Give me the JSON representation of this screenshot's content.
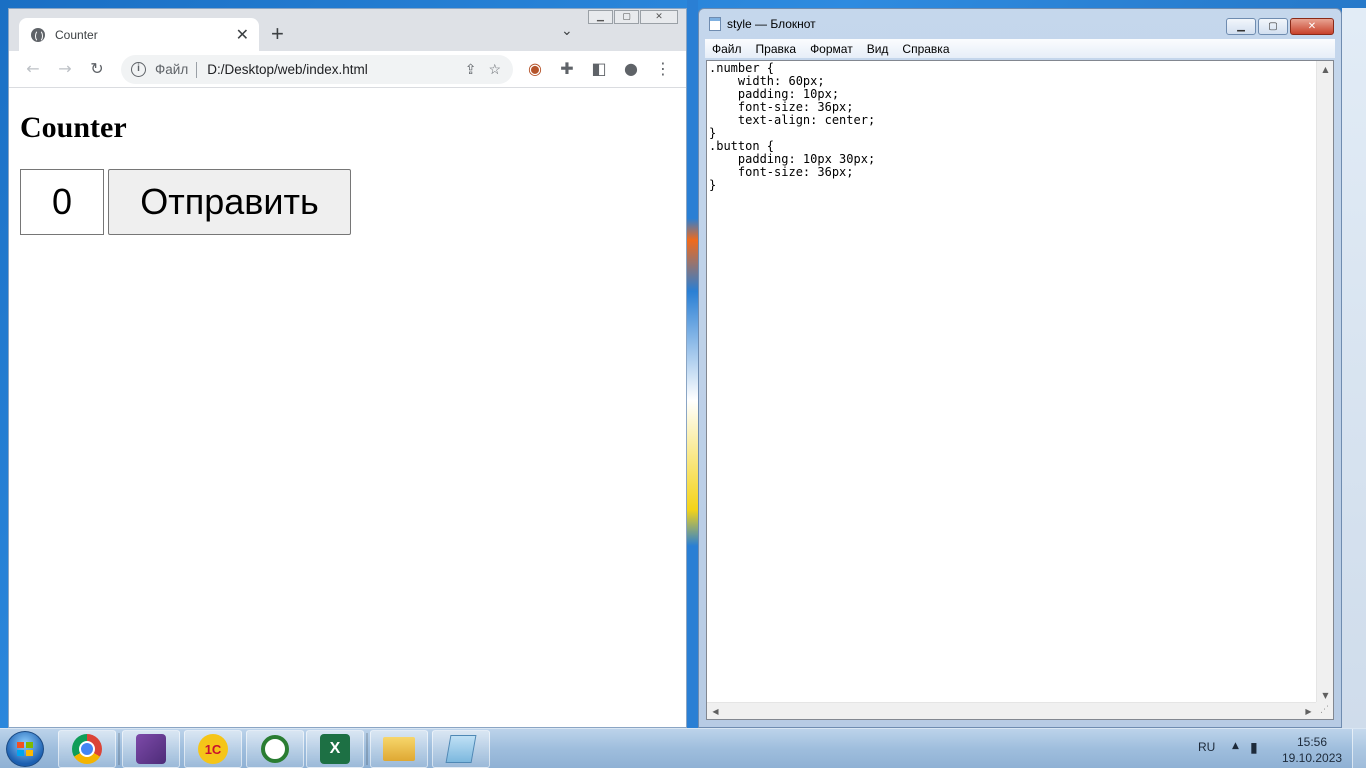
{
  "browser": {
    "tab": {
      "title": "Counter",
      "close": "✕"
    },
    "new_tab": "+",
    "tab_search": "⌄",
    "window_controls": {
      "minimize": "▁",
      "maximize": "▢",
      "close": "✕"
    },
    "toolbar": {
      "back": "←",
      "forward": "→",
      "reload": "↻",
      "address": {
        "info": "i",
        "scheme": "Файл",
        "url": "D:/Desktop/web/index.html"
      },
      "share": "⇪",
      "bookmark": "☆",
      "extension_spy": "◉",
      "extensions": "✚",
      "side_panel": "◧",
      "profile": "●",
      "menu": "⋮"
    },
    "page": {
      "heading": "Counter",
      "counter_value": "0",
      "send_label": "Отправить"
    }
  },
  "notepad": {
    "title": "style — Блокнот",
    "window_controls": {
      "minimize": "▁",
      "maximize": "▢",
      "close": "✕"
    },
    "menu": [
      "Файл",
      "Правка",
      "Формат",
      "Вид",
      "Справка"
    ],
    "content": ".number {\n    width: 60px;\n    padding: 10px;\n    font-size: 36px;\n    text-align: center;\n}\n.button {\n    padding: 10px 30px;\n    font-size: 36px;\n}",
    "scroll": {
      "up": "▲",
      "down": "▼",
      "left": "◀",
      "right": "▶",
      "grip": "⋰"
    }
  },
  "taskbar": {
    "pinned_labels": {
      "viber": "",
      "onec": "1С",
      "excel": "X"
    },
    "tray": {
      "language": "RU",
      "show_hidden": "▲",
      "network": "▮",
      "time": "15:56",
      "date": "19.10.2023"
    }
  }
}
